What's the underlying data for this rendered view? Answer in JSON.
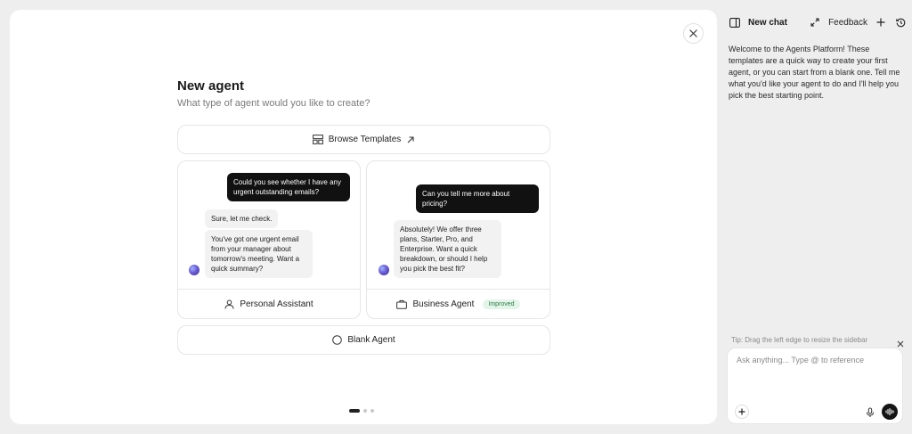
{
  "modal": {
    "title": "New agent",
    "subtitle": "What type of agent would you like to create?",
    "browse_label": "Browse Templates",
    "blank_label": "Blank Agent"
  },
  "cards": {
    "personal": {
      "user_msg": "Could you see whether I have any urgent outstanding emails?",
      "bot_msg_1": "Sure, let me check.",
      "bot_msg_2": "You've got one urgent email from your manager about tomorrow's meeting. Want a quick summary?",
      "label": "Personal Assistant"
    },
    "business": {
      "user_msg": "Can you tell me more about pricing?",
      "bot_msg_1": "Absolutely! We offer three plans, Starter, Pro, and Enterprise. Want a quick breakdown, or should I help you pick the best fit?",
      "label": "Business Agent",
      "badge": "Improved"
    }
  },
  "pager": {
    "pages": 3,
    "active": 0
  },
  "sidebar": {
    "title": "New chat",
    "feedback": "Feedback",
    "welcome": "Welcome to the Agents Platform! These templates are a quick way to create your first agent, or you can start from a blank one. Tell me what you'd like your agent to do and I'll help you pick the best starting point.",
    "tip": "Tip: Drag the left edge to resize the sidebar",
    "input_placeholder": "Ask anything... Type @ to reference"
  }
}
